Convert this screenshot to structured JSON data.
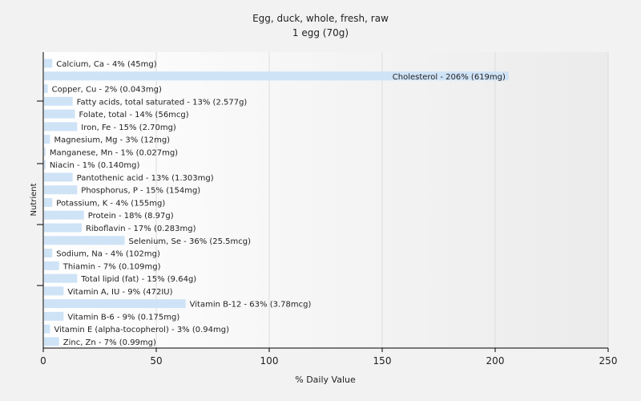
{
  "chart_data": {
    "type": "bar",
    "orientation": "horizontal",
    "title": "Egg, duck, whole, fresh, raw",
    "subtitle": "1 egg (70g)",
    "xlabel": "% Daily Value",
    "ylabel": "Nutrient",
    "xlim": [
      0,
      250
    ],
    "xticks": [
      0,
      50,
      100,
      150,
      200,
      250
    ],
    "grid": true,
    "bar_color": "#cfe3f7",
    "categories": [
      "Calcium, Ca",
      "Cholesterol",
      "Copper, Cu",
      "Fatty acids, total saturated",
      "Folate, total",
      "Iron, Fe",
      "Magnesium, Mg",
      "Manganese, Mn",
      "Niacin",
      "Pantothenic acid",
      "Phosphorus, P",
      "Potassium, K",
      "Protein",
      "Riboflavin",
      "Selenium, Se",
      "Sodium, Na",
      "Thiamin",
      "Total lipid (fat)",
      "Vitamin A, IU",
      "Vitamin B-12",
      "Vitamin B-6",
      "Vitamin E (alpha-tocopherol)",
      "Zinc, Zn"
    ],
    "values": [
      4,
      206,
      2,
      13,
      14,
      15,
      3,
      1,
      1,
      13,
      15,
      4,
      18,
      17,
      36,
      4,
      7,
      15,
      9,
      63,
      9,
      3,
      7
    ],
    "labels": [
      "Calcium, Ca - 4% (45mg)",
      "Cholesterol - 206% (619mg)",
      "Copper, Cu - 2% (0.043mg)",
      "Fatty acids, total saturated - 13% (2.577g)",
      "Folate, total - 14% (56mcg)",
      "Iron, Fe - 15% (2.70mg)",
      "Magnesium, Mg - 3% (12mg)",
      "Manganese, Mn - 1% (0.027mg)",
      "Niacin - 1% (0.140mg)",
      "Pantothenic acid - 13% (1.303mg)",
      "Phosphorus, P - 15% (154mg)",
      "Potassium, K - 4% (155mg)",
      "Protein - 18% (8.97g)",
      "Riboflavin - 17% (0.283mg)",
      "Selenium, Se - 36% (25.5mcg)",
      "Sodium, Na - 4% (102mg)",
      "Thiamin - 7% (0.109mg)",
      "Total lipid (fat) - 15% (9.64g)",
      "Vitamin A, IU - 9% (472IU)",
      "Vitamin B-12 - 63% (3.78mcg)",
      "Vitamin B-6 - 9% (0.175mg)",
      "Vitamin E (alpha-tocopherol) - 3% (0.94mg)",
      "Zinc, Zn - 7% (0.99mg)"
    ],
    "inside_label_indices": [
      1
    ]
  }
}
